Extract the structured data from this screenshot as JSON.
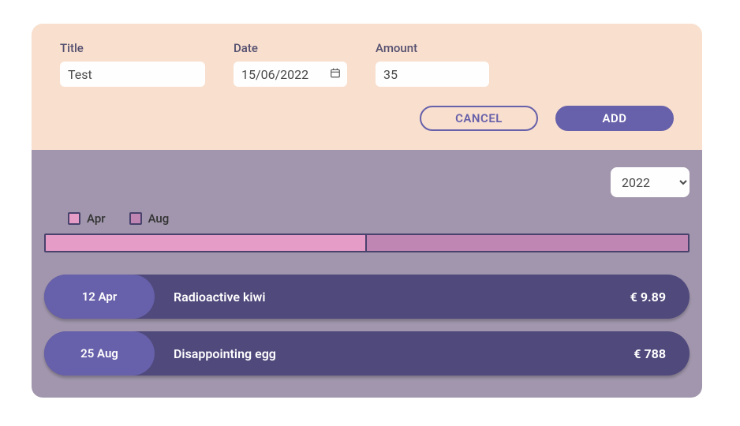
{
  "form": {
    "title_label": "Title",
    "title_value": "Test",
    "date_label": "Date",
    "date_value": "15/06/2022",
    "amount_label": "Amount",
    "amount_value": "35",
    "cancel_label": "CANCEL",
    "add_label": "ADD"
  },
  "filter": {
    "selected_year": "2022"
  },
  "chart_data": {
    "type": "bar",
    "categories": [
      "Apr",
      "Aug"
    ],
    "values": [
      50,
      50
    ],
    "colors": [
      "#e59cc7",
      "#c086b3"
    ],
    "orientation": "horizontal-stacked"
  },
  "colors": {
    "apr": "#e59cc7",
    "aug": "#c086b3"
  },
  "legend": [
    {
      "label": "Apr",
      "color": "#e59cc7"
    },
    {
      "label": "Aug",
      "color": "#c086b3"
    }
  ],
  "expenses": [
    {
      "date": "12 Apr",
      "title": "Radioactive kiwi",
      "amount": "€ 9.89"
    },
    {
      "date": "25 Aug",
      "title": "Disappointing egg",
      "amount": "€ 788"
    }
  ]
}
